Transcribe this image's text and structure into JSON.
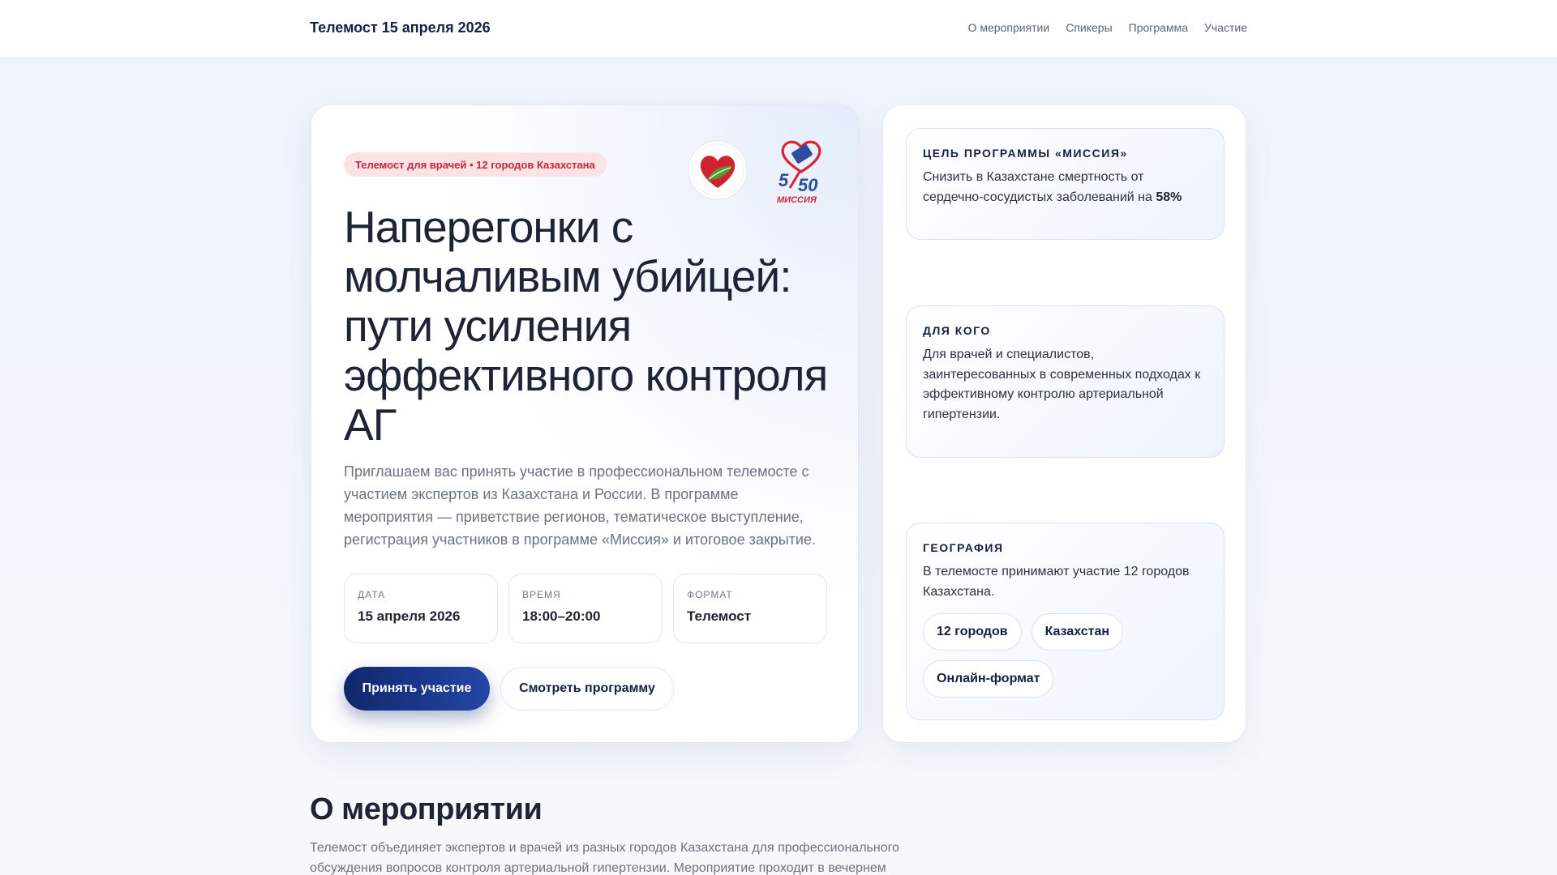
{
  "header": {
    "brand": "Телемост 15 апреля 2026",
    "nav": [
      "О мероприятии",
      "Спикеры",
      "Программа",
      "Участие"
    ]
  },
  "hero": {
    "pill": "Телемост для врачей • 12 городов Казахстана",
    "logos": {
      "left_icon": "heart-leaf-logo",
      "right_icon": "mission-5-50-logo",
      "right_text_number": "50",
      "right_text_digit": "5",
      "right_text_word": "МИССИЯ"
    },
    "title": "Наперегонки с молчаливым убийцей: пути усиления эффективного контроля АГ",
    "description": "Приглашаем вас принять участие в профессиональном телемосте с участием экспертов из Казахстана и России. В программе мероприятия — приветствие регионов, тематическое выступление, регистрация участников в программе «Миссия» и итоговое закрытие.",
    "meta": [
      {
        "label": "Дата",
        "value": "15 апреля 2026"
      },
      {
        "label": "Время",
        "value": "18:00–20:00"
      },
      {
        "label": "Формат",
        "value": "Телемост"
      }
    ],
    "primary_button": "Принять участие",
    "secondary_button": "Смотреть программу"
  },
  "sidebar": {
    "goal": {
      "heading": "Цель программы «Миссия»",
      "text": "Снизить в Казахстане смертность от сердечно-сосудистых заболеваний на ",
      "highlight": "58%"
    },
    "audience": {
      "heading": "Для кого",
      "text": "Для врачей и специалистов, заинтересованных в современных подходах к эффективному контролю артериальной гипертензии."
    },
    "geography": {
      "heading": "География",
      "text": "В телемосте принимают участие 12 городов Казахстана.",
      "tags": [
        "12 городов",
        "Казахстан",
        "Онлайн-формат"
      ]
    }
  },
  "about": {
    "title": "О мероприятии",
    "text": "Телемост объединяет экспертов и врачей из разных городов Казахстана для профессионального обсуждения вопросов контроля артериальной гипертензии. Мероприятие проходит в вечернем"
  },
  "colors": {
    "accent": "#10276a",
    "pill_bg": "#fbe3e5",
    "pill_text": "#c8263a"
  }
}
